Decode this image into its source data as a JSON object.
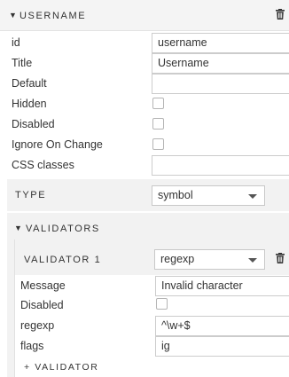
{
  "header": {
    "title": "USERNAME",
    "caret_icon": "caret-down-icon",
    "delete_icon": "trash-icon"
  },
  "fields": {
    "id": {
      "label": "id",
      "value": "username"
    },
    "title": {
      "label": "Title",
      "value": "Username"
    },
    "default": {
      "label": "Default",
      "value": ""
    },
    "hidden": {
      "label": "Hidden",
      "checked": false
    },
    "disabled": {
      "label": "Disabled",
      "checked": false
    },
    "ignore_on_change": {
      "label": "Ignore On Change",
      "checked": false
    },
    "css_classes": {
      "label": "CSS classes",
      "value": ""
    }
  },
  "type": {
    "label": "TYPE",
    "selected": "symbol"
  },
  "validators": {
    "title": "VALIDATORS",
    "items": [
      {
        "title": "VALIDATOR 1",
        "selected": "regexp",
        "message": {
          "label": "Message",
          "value": "Invalid character"
        },
        "disabled": {
          "label": "Disabled",
          "checked": false
        },
        "regexp": {
          "label": "regexp",
          "value": "^\\w+$"
        },
        "flags": {
          "label": "flags",
          "value": "ig"
        }
      }
    ],
    "add_label": "+ VALIDATOR"
  },
  "colors": {
    "header_bg": "#f4f4f4",
    "panel_bg": "#f2f2f2",
    "border": "#cccccc",
    "text": "#333333"
  }
}
